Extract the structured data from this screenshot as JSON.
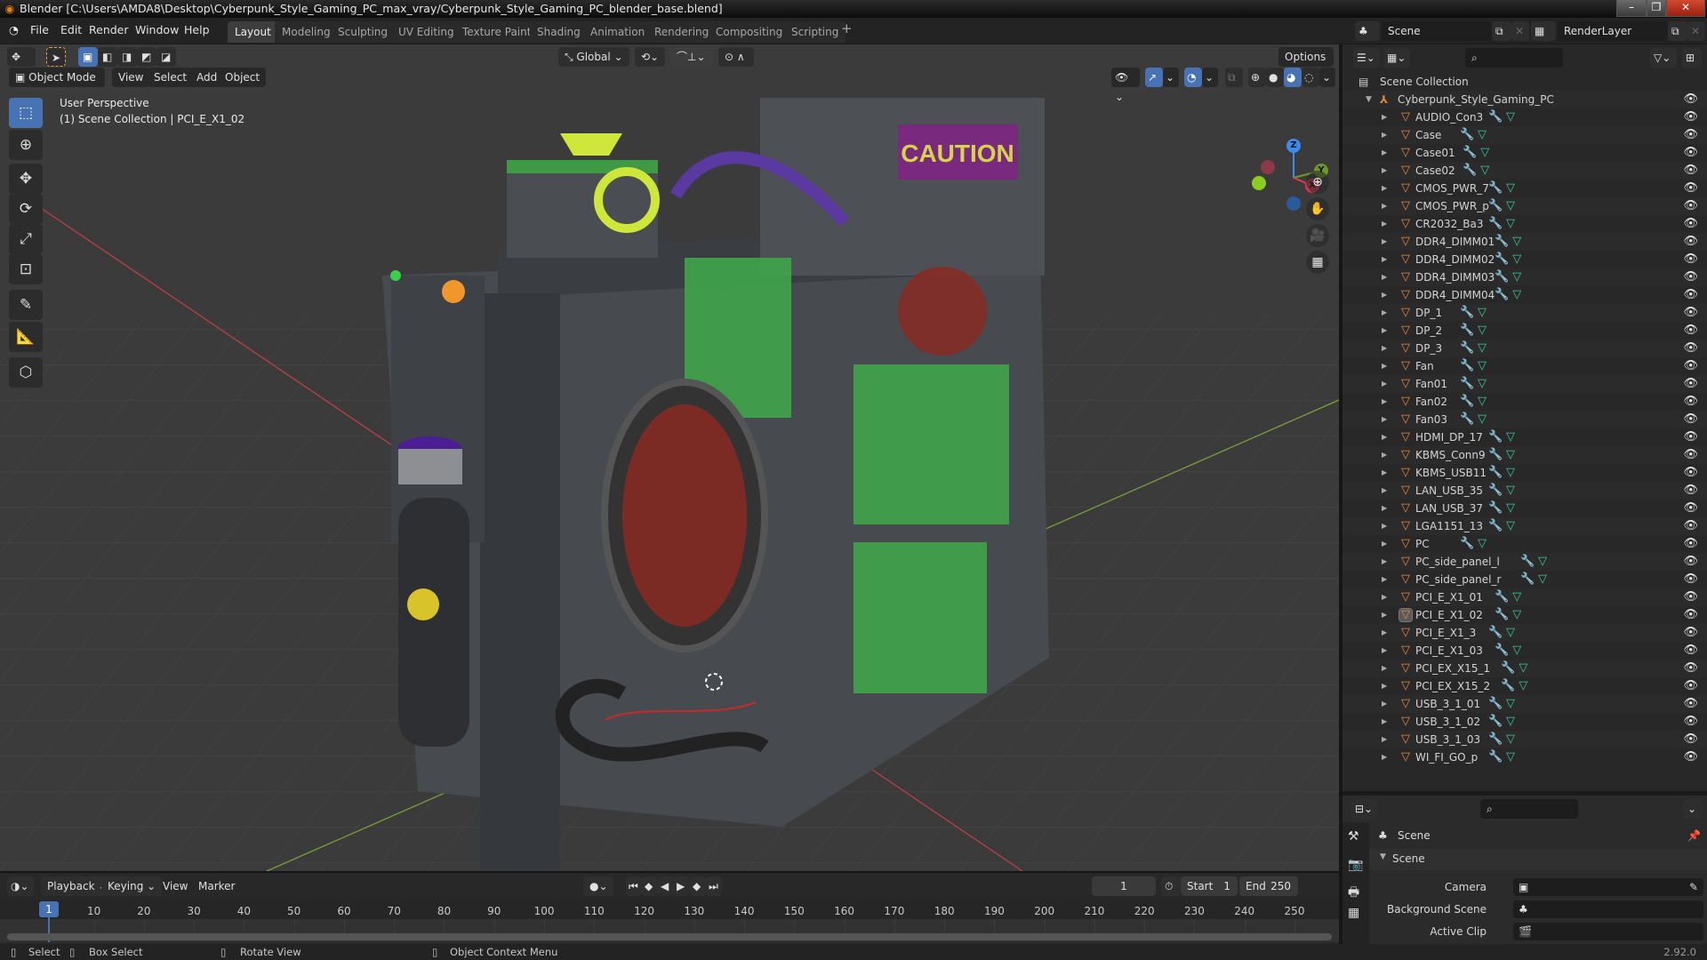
{
  "window": {
    "title": "Blender [C:\\Users\\AMDA8\\Desktop\\Cyberpunk_Style_Gaming_PC_max_vray/Cyberpunk_Style_Gaming_PC_blender_base.blend]",
    "controls": {
      "minimize": "–",
      "maximize": "❐",
      "close": "✕"
    }
  },
  "menu": [
    "File",
    "Edit",
    "Render",
    "Window",
    "Help"
  ],
  "workspaces": [
    {
      "label": "Layout",
      "active": true
    },
    {
      "label": "Modeling"
    },
    {
      "label": "Sculpting"
    },
    {
      "label": "UV Editing"
    },
    {
      "label": "Texture Paint"
    },
    {
      "label": "Shading"
    },
    {
      "label": "Animation"
    },
    {
      "label": "Rendering"
    },
    {
      "label": "Compositing"
    },
    {
      "label": "Scripting"
    }
  ],
  "add_workspace": "+",
  "scene_selector": {
    "scene": "Scene",
    "view_layer": "RenderLayer"
  },
  "viewport": {
    "transform_orientation": "Global",
    "options_label": "Options",
    "mode": "Object Mode",
    "header_menus": [
      "View",
      "Select",
      "Add",
      "Object"
    ],
    "overlay_title": "User Perspective",
    "overlay_subtitle": "(1) Scene Collection | PCI_E_X1_02",
    "caution_text": "CAUTION",
    "tools": [
      "select-box",
      "cursor",
      "move",
      "rotate",
      "scale",
      "transform",
      "annotate",
      "measure",
      "add-cube"
    ],
    "axes": {
      "x": "X",
      "y": "Y",
      "z": "Z"
    },
    "axis_colors": {
      "x": "#e8384f",
      "y": "#6b9a2a",
      "z": "#3b8cf0"
    }
  },
  "outliner": {
    "root": "Scene Collection",
    "collection": "Cyberpunk_Style_Gaming_PC",
    "selected": "PCI_E_X1_02",
    "objects": [
      "AUDIO_Con3",
      "Case",
      "Case01",
      "Case02",
      "CMOS_PWR_7",
      "CMOS_PWR_p",
      "CR2032_Ba3",
      "DDR4_DIMM01",
      "DDR4_DIMM02",
      "DDR4_DIMM03",
      "DDR4_DIMM04",
      "DP_1",
      "DP_2",
      "DP_3",
      "Fan",
      "Fan01",
      "Fan02",
      "Fan03",
      "HDMI_DP_17",
      "KBMS_Conn9",
      "KBMS_USB11",
      "LAN_USB_35",
      "LAN_USB_37",
      "LGA1151_13",
      "PC",
      "PC_side_panel_l",
      "PC_side_panel_r",
      "PCI_E_X1_01",
      "PCI_E_X1_02",
      "PCI_E_X1_3",
      "PCI_E_X1_03",
      "PCI_EX_X15_1",
      "PCI_EX_X15_2",
      "USB_3_1_01",
      "USB_3_1_02",
      "USB_3_1_03",
      "WI_FI_GO_p"
    ]
  },
  "properties": {
    "context": "Scene",
    "panel": "Scene",
    "fields": [
      {
        "label": "Camera",
        "value": ""
      },
      {
        "label": "Background Scene",
        "value": ""
      },
      {
        "label": "Active Clip",
        "value": ""
      }
    ]
  },
  "timeline": {
    "menus": [
      "Playback",
      "Keying",
      "View",
      "Marker"
    ],
    "current_frame": "1",
    "start_label": "Start",
    "start": "1",
    "end_label": "End",
    "end": "250",
    "ticks": [
      "10",
      "20",
      "30",
      "40",
      "50",
      "60",
      "70",
      "80",
      "90",
      "100",
      "110",
      "120",
      "130",
      "140",
      "150",
      "160",
      "170",
      "180",
      "190",
      "200",
      "210",
      "220",
      "230",
      "240",
      "250"
    ]
  },
  "status": {
    "items": [
      "Select",
      "Box Select",
      "Rotate View",
      "Object Context Menu"
    ],
    "version": "2.92.0"
  }
}
